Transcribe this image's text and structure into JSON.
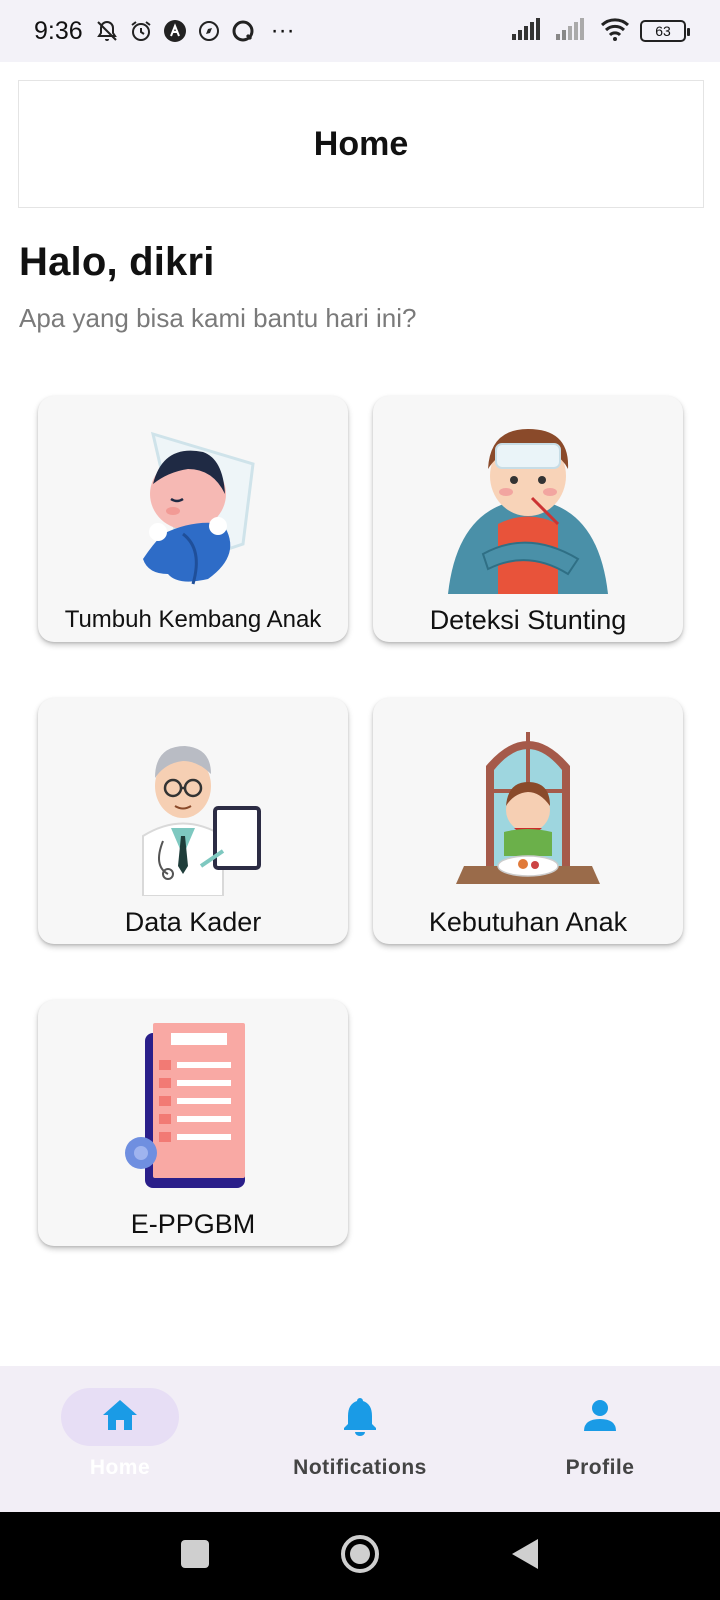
{
  "status_bar": {
    "time": "9:36",
    "battery": "63",
    "more": "···"
  },
  "app_bar": {
    "title": "Home"
  },
  "greeting": {
    "title": "Halo, dikri",
    "subtitle": "Apa yang bisa kami bantu hari ini?"
  },
  "menu": [
    {
      "label": "Tumbuh Kembang Anak",
      "icon": "sleeping-baby-illustration"
    },
    {
      "label": "Deteksi Stunting",
      "icon": "sick-child-illustration"
    },
    {
      "label": "Data Kader",
      "icon": "doctor-illustration"
    },
    {
      "label": "Kebutuhan Anak",
      "icon": "child-eating-illustration"
    },
    {
      "label": "E-PPGBM",
      "icon": "checklist-document-illustration"
    }
  ],
  "bottom_nav": {
    "items": [
      {
        "label": "Home",
        "icon": "home-icon",
        "active": true
      },
      {
        "label": "Notifications",
        "icon": "bell-icon",
        "active": false
      },
      {
        "label": "Profile",
        "icon": "person-icon",
        "active": false
      }
    ],
    "accent": "#1a9be6"
  }
}
